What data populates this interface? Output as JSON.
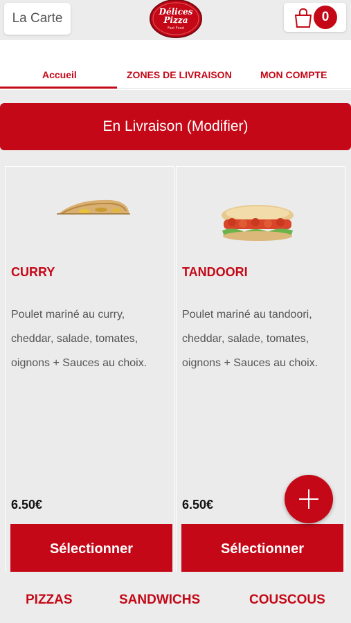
{
  "header": {
    "menu_label": "La Carte",
    "logo_line1": "Délices",
    "logo_line2": "Pizza",
    "logo_tagline": "Fast Food",
    "cart_count": "0",
    "cart_icon": "shopping-bag-icon"
  },
  "nav": {
    "tabs": [
      {
        "label": "Accueil"
      },
      {
        "label": "ZONES DE LIVRAISON"
      },
      {
        "label": "MON COMPTE"
      }
    ]
  },
  "delivery": {
    "label": "En Livraison (Modifier)"
  },
  "products": [
    {
      "title": "CURRY",
      "description": "Poulet mariné au curry, cheddar, salade, tomates, oignons  + Sauces au choix.",
      "price": "6.50€",
      "button": "Sélectionner"
    },
    {
      "title": "TANDOORI",
      "description": "Poulet mariné au tandoori, cheddar, salade, tomates, oignons  + Sauces au choix.",
      "price": "6.50€",
      "button": "Sélectionner"
    }
  ],
  "fab": {
    "icon": "plus-icon"
  },
  "categories": [
    {
      "label": "PIZZAS"
    },
    {
      "label": "SANDWICHS"
    },
    {
      "label": "COUSCOUS"
    }
  ],
  "colors": {
    "brand": "#c40817",
    "background": "#ececec"
  }
}
